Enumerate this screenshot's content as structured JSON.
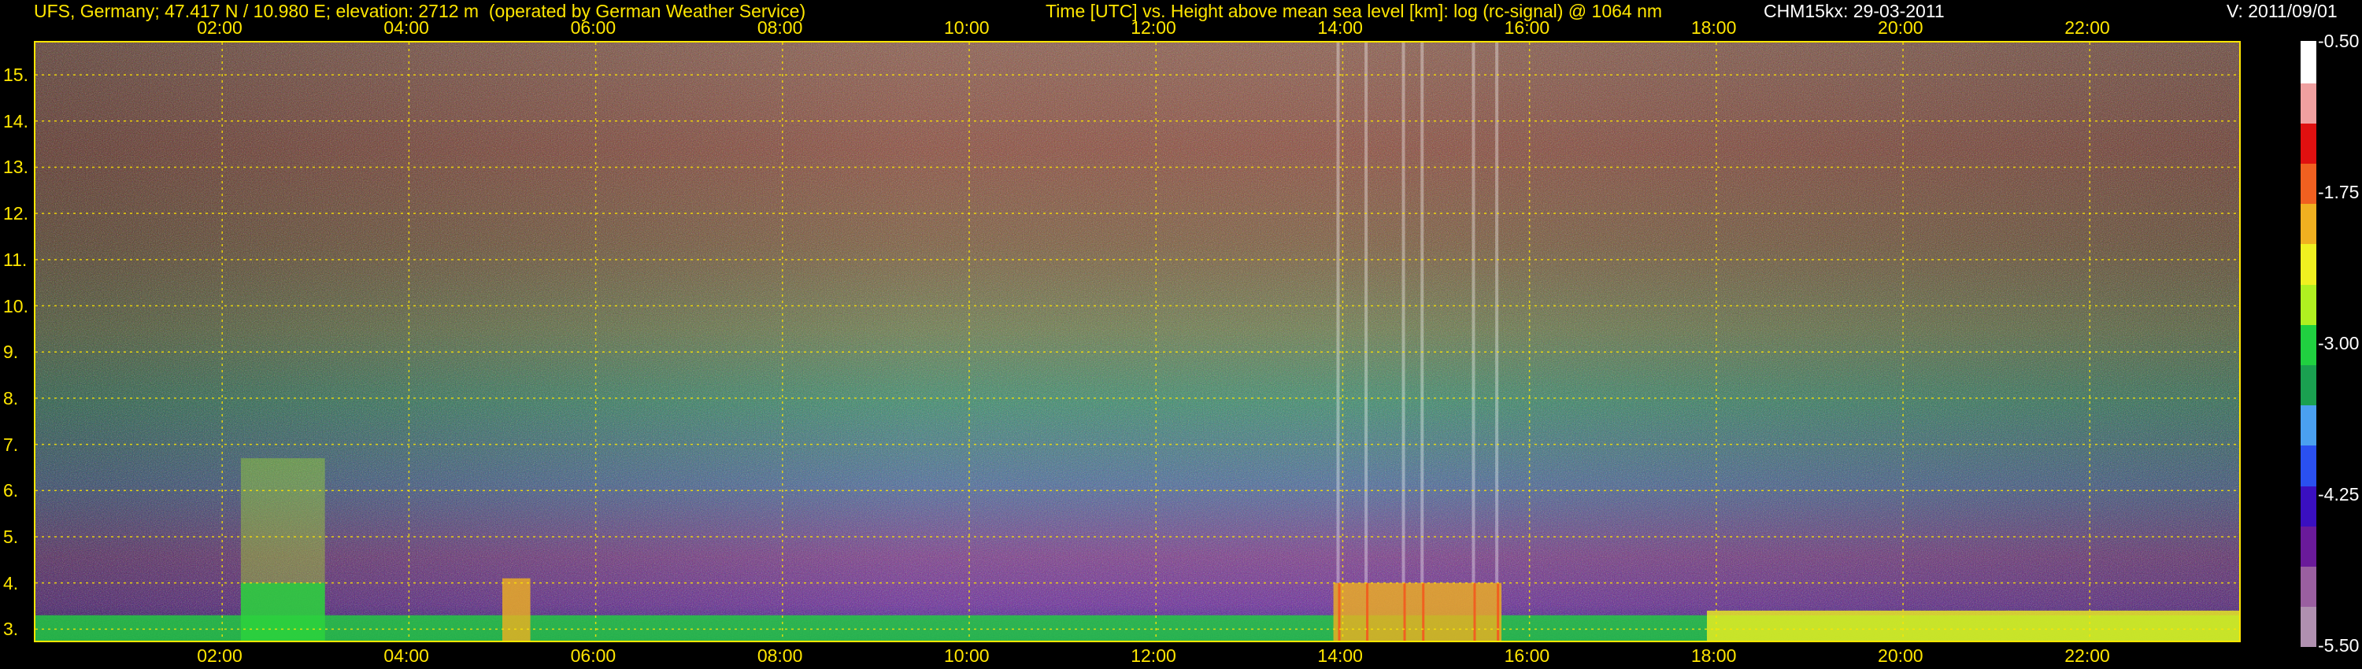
{
  "header": {
    "site": "UFS, Germany; 47.417 N / 10.980 E; elevation: 2712 m  (operated by German Weather Service)",
    "plot_title": "Time [UTC] vs. Height above mean sea level [km]: log (rc-signal) @ 1064 nm",
    "instrument": "CHM15kx: 29-03-2011",
    "version": "V: 2011/09/01"
  },
  "chart_data": {
    "type": "heatmap",
    "title": "Time [UTC] vs. Height above mean sea level [km]: log (rc-signal) @ 1064 nm",
    "xlabel": "Time [UTC]",
    "ylabel": "Height above mean sea level [km]",
    "x_unit": "hours UTC",
    "x_range": [
      0.0,
      23.6
    ],
    "y_range": [
      2.75,
      15.7
    ],
    "x_ticks": [
      "02:00",
      "04:00",
      "06:00",
      "08:00",
      "10:00",
      "12:00",
      "14:00",
      "16:00",
      "18:00",
      "20:00",
      "22:00"
    ],
    "y_ticks": [
      "3.",
      "4.",
      "5.",
      "6.",
      "7.",
      "8.",
      "9.",
      "10.",
      "11.",
      "12.",
      "13.",
      "14.",
      "15."
    ],
    "grid": true,
    "colorbar": {
      "ticks": [
        "-0.50",
        "-1.75",
        "-3.00",
        "-4.25",
        "-5.50"
      ],
      "range": [
        -5.5,
        -0.5
      ],
      "colors": [
        "#b090b0",
        "#9a5fa0",
        "#6a1a9a",
        "#3a0fc0",
        "#2a50f0",
        "#4aa0f0",
        "#1aa050",
        "#20d040",
        "#b0f020",
        "#f0f020",
        "#f0b020",
        "#f06020",
        "#e01010",
        "#f0a0a0",
        "#ffffff"
      ]
    },
    "features": [
      {
        "name": "boundary_layer",
        "x_start": 0.0,
        "x_end": 23.6,
        "top_km": 3.3,
        "log_signal": -3.0
      },
      {
        "name": "cloud_column",
        "x_start": 2.2,
        "x_end": 3.1,
        "top_km": 6.7,
        "log_signal": -2.8
      },
      {
        "name": "dense_layer",
        "x_start": 2.2,
        "x_end": 3.1,
        "top_km": 4.0,
        "log_signal": -3.0
      },
      {
        "name": "low_cloud",
        "x_start": 5.0,
        "x_end": 5.3,
        "top_km": 4.1,
        "log_signal": -1.9
      },
      {
        "name": "convective_spikes",
        "x_start": 13.9,
        "x_end": 15.7,
        "top_km": 4.0,
        "log_signal": -1.8
      },
      {
        "name": "green_layer",
        "x_start": 17.9,
        "x_end": 23.6,
        "top_km": 3.4,
        "log_signal": -2.3
      }
    ]
  }
}
